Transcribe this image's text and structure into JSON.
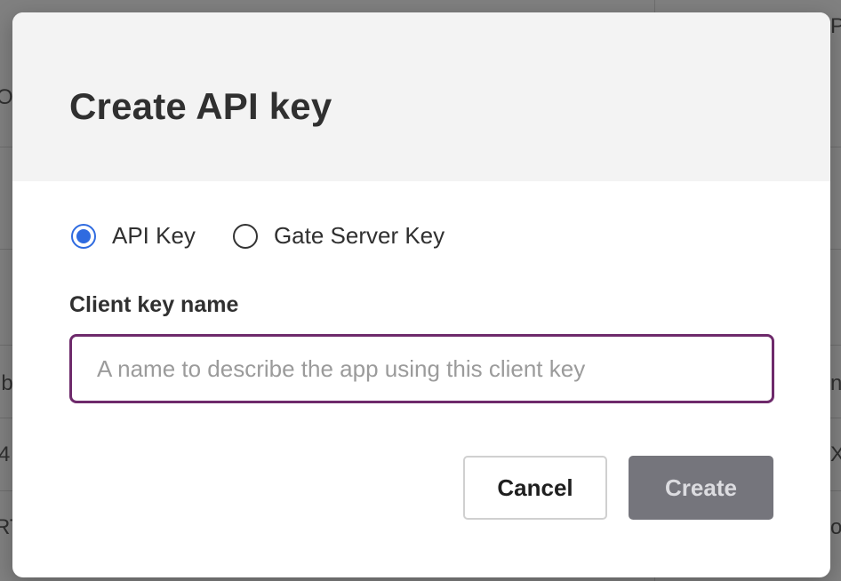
{
  "dialog": {
    "title": "Create API key",
    "key_type": {
      "options": [
        {
          "label": "API Key",
          "selected": true
        },
        {
          "label": "Gate Server Key",
          "selected": false
        }
      ]
    },
    "client_key_name": {
      "label": "Client key name",
      "value": "",
      "placeholder": "A name to describe the app using this client key"
    },
    "buttons": {
      "cancel_label": "Cancel",
      "create_label": "Create"
    }
  },
  "colors": {
    "accent": "#2f6be0",
    "input_focus_border": "#6e2a6b",
    "create_button_bg": "#75757c",
    "header_bg": "#f3f3f3",
    "overlay": "#808080"
  },
  "background": {
    "partial_text": [
      "OL",
      "lb",
      "4",
      "RT",
      "P",
      "n",
      "X",
      "o"
    ]
  }
}
